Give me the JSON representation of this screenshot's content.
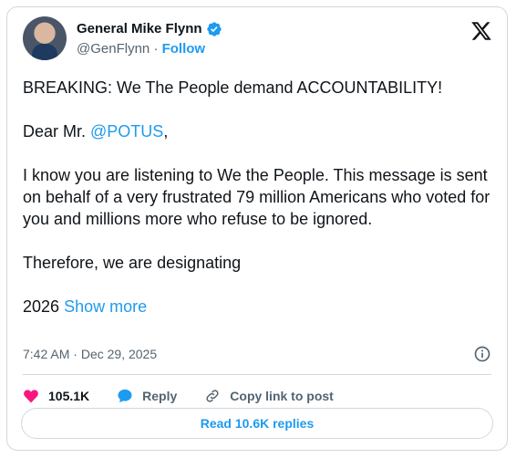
{
  "author": {
    "name": "General Mike Flynn",
    "handle": "@GenFlynn",
    "separator": "·",
    "follow_label": "Follow",
    "verified_color": "#1d9bf0"
  },
  "icons": {
    "platform": "x-logo-icon",
    "verified": "verified-badge-icon",
    "info": "info-icon",
    "like": "heart-icon",
    "reply": "reply-icon",
    "copy_link": "link-icon"
  },
  "post": {
    "line1": "BREAKING: We The People demand ACCOUNTABILITY!",
    "dear_prefix": "Dear Mr.",
    "mention": "@POTUS",
    "dear_suffix": ",",
    "paragraph": "I know you are listening to We the People. This message is sent on behalf of a very frustrated 79 million Americans who voted for you and millions more who refuse to be ignored.",
    "therefore": "Therefore, we are designating",
    "last_prefix": "2026",
    "show_more": "Show more"
  },
  "meta": {
    "time": "7:42 AM",
    "separator": "·",
    "date": "Dec 29, 2025"
  },
  "actions": {
    "likes": "105.1K",
    "reply_label": "Reply",
    "copy_label": "Copy link to post"
  },
  "footer": {
    "read_replies": "Read 10.6K replies"
  },
  "colors": {
    "accent": "#1d9bf0",
    "like": "#f91880",
    "text": "#0f1419",
    "muted": "#536471",
    "border": "#cfd9de"
  }
}
